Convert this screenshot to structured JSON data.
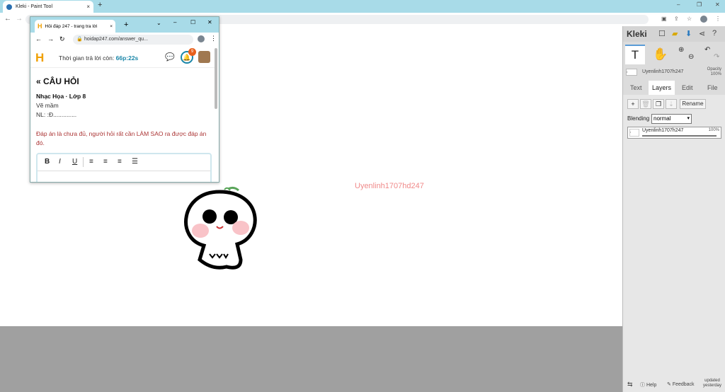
{
  "browser": {
    "tab_title": "Kleki - Paint Tool",
    "tab_close": "×",
    "new_tab": "+",
    "window_controls": [
      "–",
      "❐",
      "✕"
    ],
    "nav_back": "←",
    "nav_forward": "→"
  },
  "canvas": {
    "watermark": "Uyenlinh1707hd247"
  },
  "kleki": {
    "logo": "Kleki",
    "brush_preview": ",",
    "brush_name": "Uyenlinh1707h247",
    "opacity_label": "Opacity",
    "opacity_value": "100%",
    "tabs": [
      "Text",
      "Layers",
      "Edit",
      "File"
    ],
    "active_tab": "Layers",
    "rename_label": "Rename",
    "blending_label": "Blending",
    "blending_value": "normal",
    "layer": {
      "name": "Uyenlinh1707h247",
      "opacity": "100%",
      "thumb": ","
    },
    "footer": {
      "help": "Help",
      "feedback": "Feedback",
      "updated": "updated yesterday"
    }
  },
  "popup": {
    "tab_title": "Hỏi đáp 247 - trang tra lời",
    "tab_close": "×",
    "new_tab": "+",
    "address": "hoidap247.com/answer_qu...",
    "timer_label": "Thời gian trả lời còn:",
    "timer_value": "66p:22s",
    "notif_count": "9",
    "question_title": "« CÂU HỎI",
    "subject": "Nhạc Họa · Lớp 8",
    "line1": "Vẽ mầm",
    "line2": "NL: :Đ..............",
    "warning": "Đáp án là chưa đủ, người hỏi rất cần LÀM SAO ra được đáp án đó.",
    "editor_buttons": [
      "B",
      "I",
      "U"
    ]
  }
}
